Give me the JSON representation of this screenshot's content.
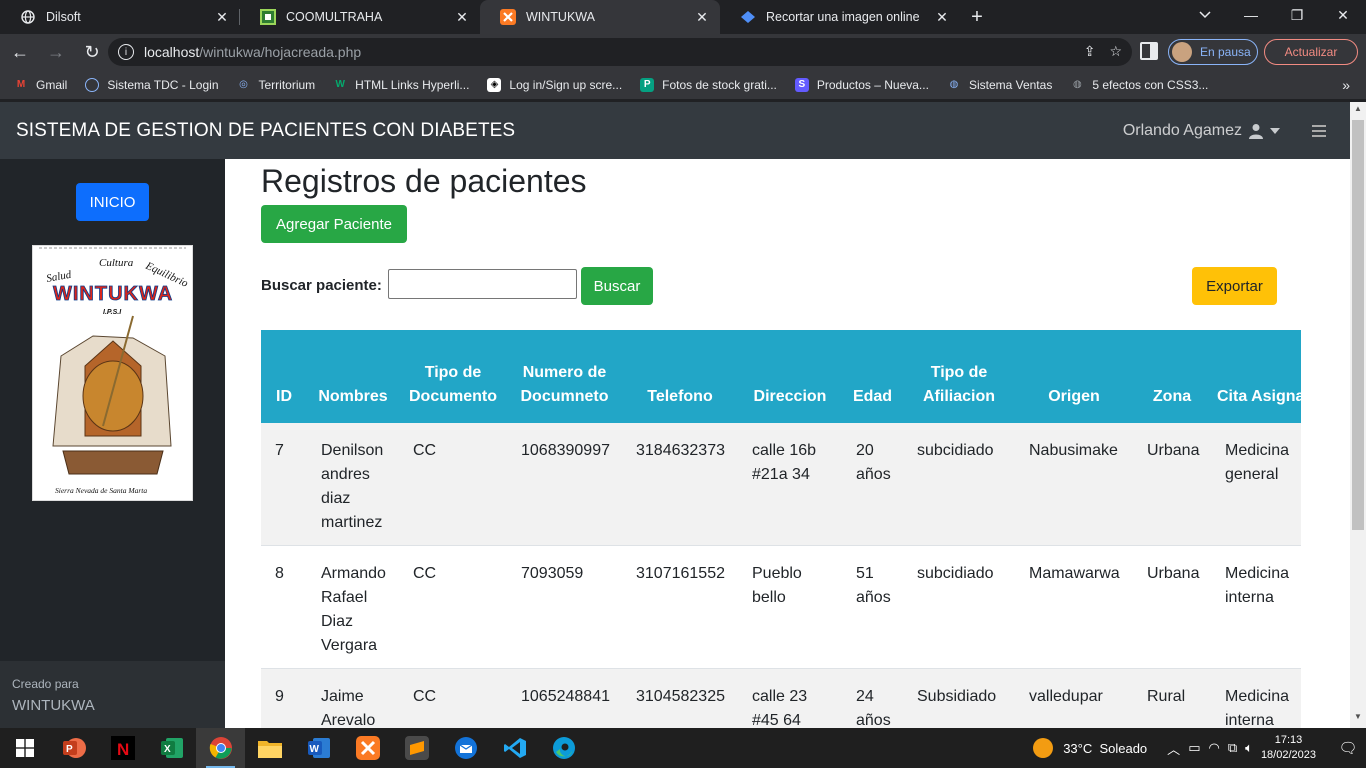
{
  "browser": {
    "tabs": [
      {
        "title": "Dilsoft",
        "icon": "globe-icon",
        "active": false
      },
      {
        "title": "COOMULTRAHA",
        "icon": "coomultraha-icon",
        "active": false
      },
      {
        "title": "WINTUKWA",
        "icon": "xampp-icon",
        "active": true
      },
      {
        "title": "Recortar una imagen online",
        "icon": "diamond-icon",
        "active": false
      }
    ],
    "url_host": "localhost",
    "url_path": "/wintukwa/hojacreada.php",
    "profile_label": "En pausa",
    "update_label": "Actualizar",
    "bookmarks": [
      {
        "label": "Gmail",
        "icon": "gmail-icon"
      },
      {
        "label": "Sistema TDC - Login",
        "icon": "circle-icon"
      },
      {
        "label": "Territorium",
        "icon": "territorium-icon"
      },
      {
        "label": "HTML Links Hyperli...",
        "icon": "w3-icon"
      },
      {
        "label": "Log in/Sign up scre...",
        "icon": "codepen-icon"
      },
      {
        "label": "Fotos de stock grati...",
        "icon": "pexels-icon"
      },
      {
        "label": "Productos – Nueva...",
        "icon": "stripe-icon"
      },
      {
        "label": "Sistema Ventas",
        "icon": "globe-icon"
      },
      {
        "label": "5 efectos con CSS3...",
        "icon": "globe-icon"
      }
    ]
  },
  "app": {
    "brand": "SISTEMA DE GESTION DE PACIENTES CON DIABETES",
    "user_name": "Orlando Agamez",
    "sidebar": {
      "inicio_label": "INICIO",
      "footer_line1": "Creado para",
      "footer_line2": "WINTUKWA"
    },
    "logo": {
      "arc_text": "Salud  Cultura  Equilibrio",
      "name": "WINTUKWA",
      "sub": "I.P.S.I",
      "caption": "Sierra Nevada de Santa Marta"
    },
    "page_title": "Registros de pacientes",
    "add_button": "Agregar Paciente",
    "search_label": "Buscar paciente:",
    "search_value": "",
    "search_button": "Buscar",
    "export_button": "Exportar",
    "table": {
      "headers": [
        "ID",
        "Nombres",
        "Tipo de Documento",
        "Numero de Documneto",
        "Telefono",
        "Direccion",
        "Edad",
        "Tipo de Afiliacion",
        "Origen",
        "Zona",
        "Cita Asignada"
      ],
      "rows": [
        [
          "7",
          "Denilson andres diaz martinez",
          "CC",
          "1068390997",
          "3184632373",
          "calle 16b #21a 34",
          "20 años",
          "subcidiado",
          "Nabusimake",
          "Urbana",
          "Medicina general"
        ],
        [
          "8",
          "Armando Rafael Diaz Vergara",
          "CC",
          "7093059",
          "3107161552",
          "Pueblo bello",
          "51 años",
          "subcidiado",
          "Mamawarwa",
          "Urbana",
          "Medicina interna"
        ],
        [
          "9",
          "Jaime Arevalo",
          "CC",
          "1065248841",
          "3104582325",
          "calle 23 #45 64",
          "24 años",
          "Subsidiado",
          "valledupar",
          "Rural",
          "Medicina interna"
        ]
      ]
    }
  },
  "taskbar": {
    "weather": "33°C  Soleado",
    "time": "17:13",
    "date": "18/02/2023",
    "apps": [
      "powerpoint-icon",
      "netflix-icon",
      "excel-icon",
      "chrome-icon",
      "file-explorer-icon",
      "word-icon",
      "xampp-icon",
      "sublime-icon",
      "thunderbird-icon",
      "vscode-icon",
      "edge-icon"
    ]
  }
}
